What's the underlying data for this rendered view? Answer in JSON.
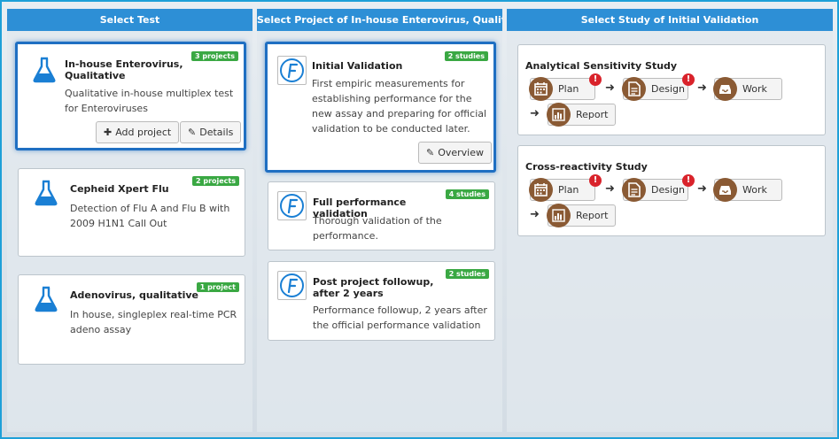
{
  "columns": {
    "tests": {
      "header": "Select Test",
      "cards": [
        {
          "title": "In-house Enterovirus, Qualitative",
          "badge": "3 projects",
          "description": "Qualitative in-house multiplex test for Enteroviruses",
          "add_project": "Add project",
          "details": "Details"
        },
        {
          "title": "Cepheid Xpert Flu",
          "badge": "2 projects",
          "description": "Detection of Flu A and Flu B with 2009 H1N1 Call Out"
        },
        {
          "title": "Adenovirus, qualitative",
          "badge": "1 project",
          "description": "In house, singleplex real-time PCR adeno assay"
        }
      ]
    },
    "projects": {
      "header": "Select Project of In-house Enterovirus, Qualitative",
      "cards": [
        {
          "title": "Initial Validation",
          "badge": "2 studies",
          "description": "First empiric measurements for establishing performance for the new assay and preparing for official validation to be conducted later.",
          "overview": "Overview"
        },
        {
          "title": "Full performance validation",
          "badge": "4 studies",
          "description": "Thorough validation of the performance."
        },
        {
          "title": "Post project followup, after 2 years",
          "badge": "2 studies",
          "description": "Performance followup, 2 years after the official performance validation"
        }
      ]
    },
    "studies": {
      "header": "Select Study of Initial Validation",
      "cards": [
        {
          "title": "Analytical Sensitivity Study",
          "steps": {
            "plan": "Plan",
            "design": "Design",
            "work": "Work",
            "report": "Report"
          }
        },
        {
          "title": "Cross-reactivity Study",
          "steps": {
            "plan": "Plan",
            "design": "Design",
            "work": "Work",
            "report": "Report"
          }
        }
      ]
    }
  },
  "colors": {
    "header_bg": "#2d8fd6",
    "badge_green": "#3aa843",
    "selected_border": "#1f6fc2",
    "step_icon_brown": "#8a5a34",
    "alert_red": "#d9232b",
    "flask_blue": "#1a7fd4"
  },
  "icons": {
    "test": "flask-icon",
    "project": "f-logo-icon",
    "plan": "calendar-icon",
    "design": "document-icon",
    "work": "inbox-icon",
    "report": "bar-chart-icon",
    "alert": "exclamation-icon",
    "add": "plus-icon",
    "edit": "edit-icon"
  }
}
